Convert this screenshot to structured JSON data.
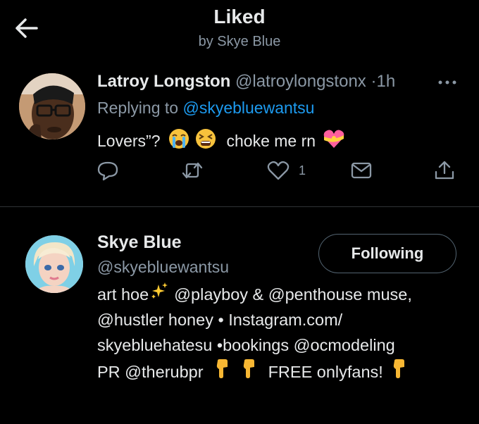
{
  "header": {
    "title": "Liked",
    "subtitle": "by Skye Blue",
    "back_icon": "arrow-left-icon"
  },
  "tweet": {
    "display_name": "Latroy Longston",
    "handle": "@latroylongstonx",
    "separator": "·",
    "time": "1h",
    "replying_prefix": "Replying to",
    "replying_handle": "@skyebluewantsu",
    "text_part1": "Lovers”?",
    "emoji1": "loudly-crying-face",
    "emoji2": "tired-face",
    "text_part2": "choke me rn",
    "emoji3": "heart-with-ribbon",
    "like_count": "1",
    "icons": [
      "reply-icon",
      "retweet-icon",
      "like-icon",
      "message-icon",
      "share-icon",
      "more-icon"
    ]
  },
  "profile": {
    "display_name": "Skye Blue",
    "handle": "@skyebluewantsu",
    "follow_label": "Following",
    "bio_lines": [
      {
        "a": "art hoe",
        "b": "@playboy & @penthouse muse,"
      },
      {
        "a": "@hustler honey • Instagram.com/"
      },
      {
        "a": "skyebluehatesu •bookings @ocmodeling"
      },
      {
        "a": "PR @therubpr",
        "b": "FREE onlyfans!"
      }
    ]
  },
  "colors": {
    "background": "#000000",
    "text": "#e7e9ea",
    "muted": "#8b98a5",
    "link": "#1d9bf0",
    "divider": "#2f3336"
  }
}
